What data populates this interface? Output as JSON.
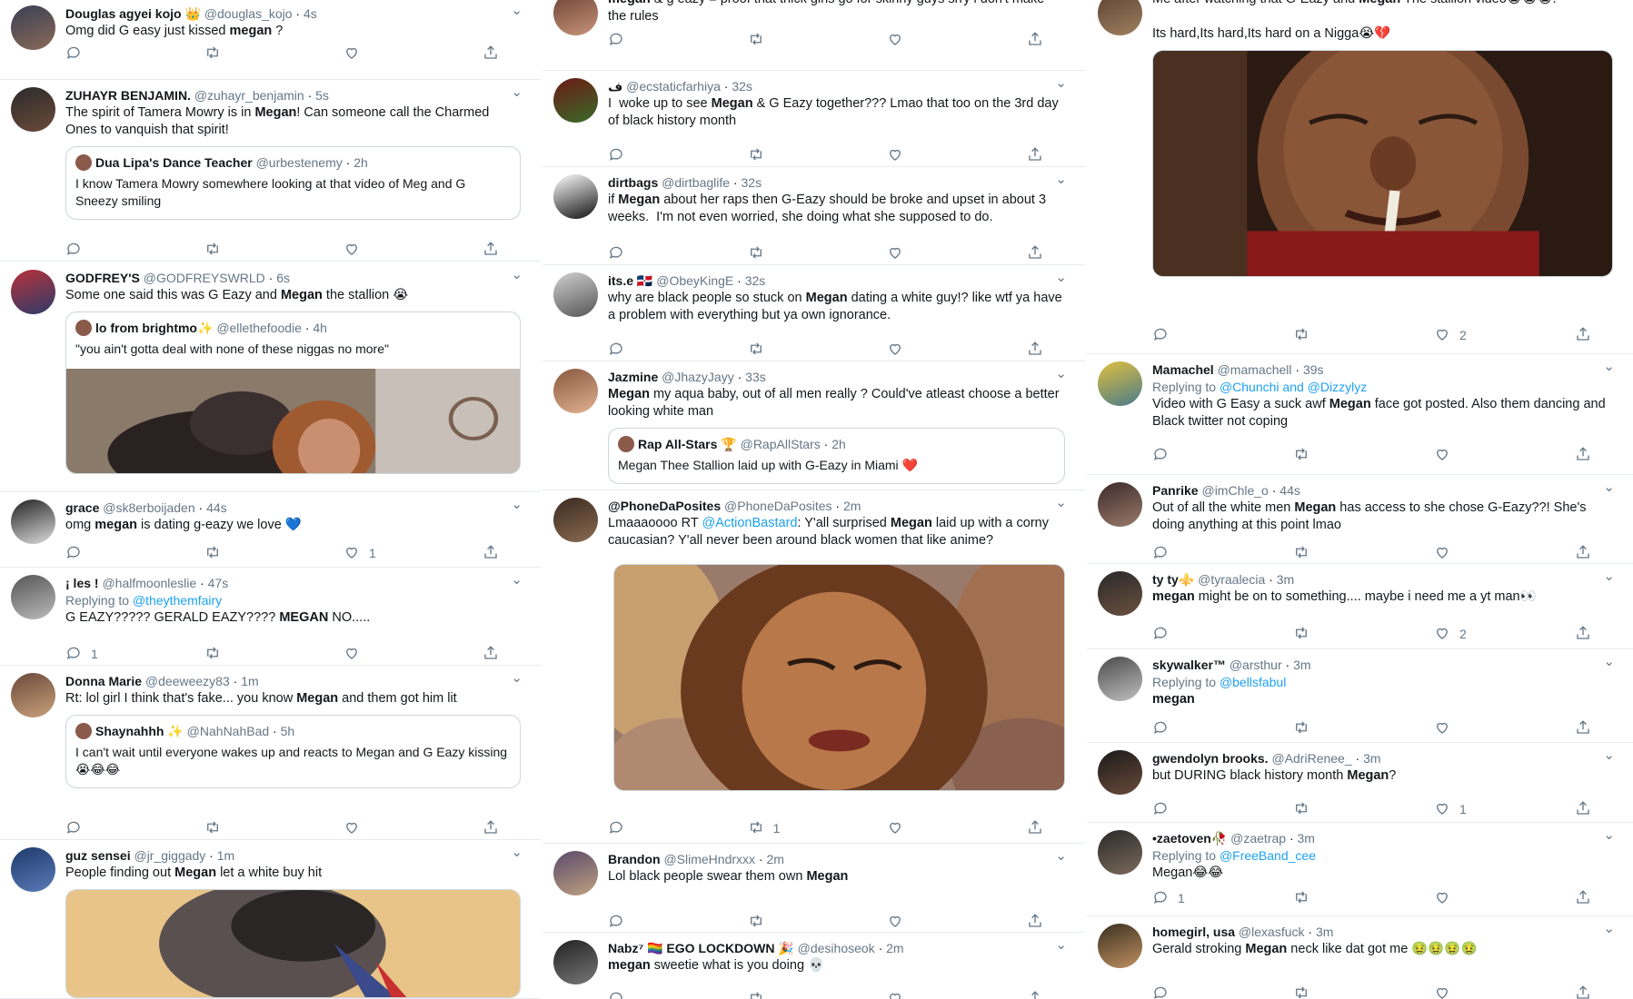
{
  "columns": [
    {
      "tweets": [
        {
          "name": "Douglas agyei kojo 👑",
          "handle": "@douglas_kojo",
          "time": "4s",
          "reply_to": "",
          "text": [
            {
              "t": "Omg did G easy just kissed "
            },
            {
              "t": "megan",
              "b": true
            },
            {
              "t": " ?"
            }
          ],
          "replies": "",
          "retweets": "",
          "likes": "",
          "avatar": [
            "#3a3f55",
            "#8a6a58"
          ]
        },
        {
          "name": "ZUHAYR BENJAMIN.",
          "handle": "@zuhayr_benjamin",
          "time": "5s",
          "reply_to": "",
          "text": [
            {
              "t": "The spirit of Tamera Mowry is in "
            },
            {
              "t": "Megan",
              "b": true
            },
            {
              "t": "! Can someone call the Charmed Ones to vanquish that spirit!"
            }
          ],
          "quote": {
            "name": "Dua Lipa's Dance Teacher",
            "handle": "@urbestenemy",
            "time": "2h",
            "text": "I know Tamera Mowry somewhere looking at that video of Meg and G Sneezy smiling",
            "media": false
          },
          "replies": "",
          "retweets": "",
          "likes": "",
          "avatar": [
            "#2b2b2b",
            "#6b4a3a"
          ]
        },
        {
          "name": "GODFREY'S",
          "handle": "@GODFREYSWRLD",
          "time": "6s",
          "reply_to": "",
          "text": [
            {
              "t": "Some one said this was G Eazy and "
            },
            {
              "t": "Megan",
              "b": true
            },
            {
              "t": " the stallion 😭"
            }
          ],
          "quote": {
            "name": "lo from brightmo✨",
            "handle": "@ellethefoodie",
            "time": "4h",
            "text": "\"you ain't gotta deal with none of these niggas no more\"",
            "media": true
          },
          "replies": "",
          "retweets": "",
          "likes": "",
          "avatar": [
            "#b8323a",
            "#2d3b6a"
          ]
        },
        {
          "name": "grace",
          "handle": "@sk8erboijaden",
          "time": "44s",
          "reply_to": "",
          "text": [
            {
              "t": "omg "
            },
            {
              "t": "megan",
              "b": true
            },
            {
              "t": " is dating g-eazy we love 💙"
            }
          ],
          "replies": "",
          "retweets": "",
          "likes": "1",
          "avatar": [
            "#222222",
            "#dddddd"
          ]
        },
        {
          "name": "¡ les !",
          "handle": "@halfmoonleslie",
          "time": "47s",
          "reply_to": "@theythemfairy",
          "text": [
            {
              "t": "G EAZY????? GERALD EAZY???? "
            },
            {
              "t": "MEGAN",
              "b": true
            },
            {
              "t": " NO....."
            }
          ],
          "replies": "1",
          "retweets": "",
          "likes": "",
          "avatar": [
            "#555555",
            "#bbbbbb"
          ]
        },
        {
          "name": "Donna Marie",
          "handle": "@deeweezy83",
          "time": "1m",
          "reply_to": "",
          "text": [
            {
              "t": "Rt: lol girl I think that's fake... you know "
            },
            {
              "t": "Megan",
              "b": true
            },
            {
              "t": " and them got him lit"
            }
          ],
          "quote": {
            "name": "Shaynahhh ✨",
            "handle": "@NahNahBad",
            "time": "5h",
            "text": "I can't wait until everyone wakes up and reacts to Megan and G Eazy kissing 😭😂😂",
            "media": false
          },
          "replies": "",
          "retweets": "",
          "likes": "",
          "avatar": [
            "#6a4a3a",
            "#c9a07a"
          ]
        },
        {
          "name": "guz sensei",
          "handle": "@jr_giggady",
          "time": "1m",
          "reply_to": "",
          "text": [
            {
              "t": "People finding out "
            },
            {
              "t": "Megan",
              "b": true
            },
            {
              "t": " let a white buy hit"
            }
          ],
          "media": "anime",
          "replies": "",
          "retweets": "",
          "likes": "",
          "avatar": [
            "#1f3a6a",
            "#5a7ab8"
          ]
        }
      ]
    },
    {
      "tweets": [
        {
          "name": "",
          "handle": "",
          "time": "",
          "reply_to": "",
          "text": [
            {
              "t": "megan",
              "b": true
            },
            {
              "t": " & g eazy = proof that thick girls go for skinny guys srry i don't make the rules"
            }
          ],
          "replies": "",
          "retweets": "",
          "likes": "",
          "avatar": [
            "#6a4030",
            "#c8937a"
          ]
        },
        {
          "name": "ف",
          "handle": "@ecstaticfarhiya",
          "time": "32s",
          "reply_to": "",
          "text": [
            {
              "t": "I  woke up to see "
            },
            {
              "t": "Megan",
              "b": true
            },
            {
              "t": " & G Eazy together??? Lmao that too on the 3rd day of black history month"
            }
          ],
          "replies": "",
          "retweets": "",
          "likes": "",
          "avatar": [
            "#6a1a14",
            "#3a6a2a"
          ]
        },
        {
          "name": "dirtbags",
          "handle": "@dirtbaglife",
          "time": "32s",
          "reply_to": "",
          "text": [
            {
              "t": "if "
            },
            {
              "t": "Megan",
              "b": true
            },
            {
              "t": " about her raps then G-Eazy should be broke and upset in about 3 weeks.  I'm not even worried, she doing what she supposed to do."
            }
          ],
          "replies": "",
          "retweets": "",
          "likes": "",
          "avatar": [
            "#ffffff",
            "#111111"
          ]
        },
        {
          "name": "its.e 🇩🇴",
          "handle": "@ObeyKingE",
          "time": "32s",
          "reply_to": "",
          "text": [
            {
              "t": "why are black people so stuck on "
            },
            {
              "t": "Megan",
              "b": true
            },
            {
              "t": " dating a white guy!? like wtf ya have a problem with everything but ya own ignorance."
            }
          ],
          "replies": "",
          "retweets": "",
          "likes": "",
          "avatar": [
            "#d0d0d0",
            "#555555"
          ]
        },
        {
          "name": "Jazmine",
          "handle": "@JhazyJayy",
          "time": "33s",
          "reply_to": "",
          "text": [
            {
              "t": "Megan",
              "b": true
            },
            {
              "t": " my aqua baby, out of all men really ? Could've atleast choose a better looking white man"
            }
          ],
          "quote": {
            "name": "Rap All-Stars 🏆",
            "handle": "@RapAllStars",
            "time": "2h",
            "text": "Megan Thee Stallion laid up with G-Eazy in Miami ❤️",
            "media": false
          },
          "replies": "",
          "retweets": "",
          "likes": "",
          "avatar": [
            "#8a5a40",
            "#e0b090"
          ]
        },
        {
          "name": "@PhoneDaPosites",
          "handle": "@PhoneDaPosites",
          "time": "2m",
          "reply_to": "",
          "text": [
            {
              "t": "Lmaaaoooo RT "
            },
            {
              "t": "@ActionBastard",
              "l": true
            },
            {
              "t": ": Y'all surprised "
            },
            {
              "t": "Megan",
              "b": true
            },
            {
              "t": " laid up with a corny caucasian? Y'all never been around black women that like anime?"
            }
          ],
          "media": "wendy",
          "replies": "",
          "retweets": "1",
          "likes": "",
          "avatar": [
            "#3a2a20",
            "#8a6a50"
          ]
        },
        {
          "name": "Brandon",
          "handle": "@SlimeHndrxxx",
          "time": "2m",
          "reply_to": "",
          "text": [
            {
              "t": "Lol black people swear them own "
            },
            {
              "t": "Megan",
              "b": true
            }
          ],
          "replies": "",
          "retweets": "",
          "likes": "",
          "avatar": [
            "#5a4a6a",
            "#c0a080"
          ]
        },
        {
          "name": "Nabz⁷ 🏳️‍🌈 EGO LOCKDOWN 🎉",
          "handle": "@desihoseok",
          "time": "2m",
          "reply_to": "",
          "text": [
            {
              "t": "megan",
              "b": true
            },
            {
              "t": " sweetie what is you doing 💀"
            }
          ],
          "replies": "",
          "retweets": "",
          "likes": "",
          "avatar": [
            "#222222",
            "#777777"
          ]
        }
      ]
    },
    {
      "tweets": [
        {
          "name": "",
          "handle": "",
          "time": "",
          "reply_to": "",
          "text": [
            {
              "t": "Me after watching that G-Eazy and "
            },
            {
              "t": "Megan",
              "b": true
            },
            {
              "t": " The stallion video😭😭😭."
            },
            {
              "t": "\n\nIts hard,Its hard,Its hard on a Nigga😭💔"
            }
          ],
          "media": "crying",
          "replies": "",
          "retweets": "",
          "likes": "2",
          "avatar": [
            "#5a4030",
            "#a08060"
          ]
        },
        {
          "name": "Mamachel",
          "handle": "@mamachell",
          "time": "39s",
          "reply_to": "@Chunchi and @Dizzylyz",
          "text": [
            {
              "t": "Video with G Easy a suck awf "
            },
            {
              "t": "Megan",
              "b": true
            },
            {
              "t": " face got posted. Also them dancing and Black twitter not coping"
            }
          ],
          "replies": "",
          "retweets": "",
          "likes": "",
          "avatar": [
            "#e0c040",
            "#4a7a8a"
          ]
        },
        {
          "name": "Panrike",
          "handle": "@imChle_o",
          "time": "44s",
          "reply_to": "",
          "text": [
            {
              "t": "Out of all the white men "
            },
            {
              "t": "Megan",
              "b": true
            },
            {
              "t": " has access to she chose G-Eazy??! She's doing anything at this point lmao"
            }
          ],
          "replies": "",
          "retweets": "",
          "likes": "",
          "avatar": [
            "#3a2a2a",
            "#9a7a6a"
          ]
        },
        {
          "name": "ty ty⚜️",
          "handle": "@tyraalecia",
          "time": "3m",
          "reply_to": "",
          "text": [
            {
              "t": "megan",
              "b": true
            },
            {
              "t": " might be on to something.... maybe i need me a yt man👀"
            }
          ],
          "replies": "",
          "retweets": "",
          "likes": "2",
          "avatar": [
            "#2a2a2a",
            "#6a5040"
          ]
        },
        {
          "name": "skywalker™",
          "handle": "@arsthur",
          "time": "3m",
          "reply_to": "@bellsfabul",
          "text": [
            {
              "t": "megan",
              "b": true
            }
          ],
          "replies": "",
          "retweets": "",
          "likes": "",
          "avatar": [
            "#4a4a4a",
            "#c0c0c0"
          ]
        },
        {
          "name": "gwendolyn brooks.",
          "handle": "@AdriRenee_",
          "time": "3m",
          "reply_to": "",
          "text": [
            {
              "t": "but DURING black history month "
            },
            {
              "t": "Megan",
              "b": true
            },
            {
              "t": "?"
            }
          ],
          "replies": "",
          "retweets": "",
          "likes": "1",
          "avatar": [
            "#1a1a1a",
            "#6a4a3a"
          ]
        },
        {
          "name": "•zaetoven🥀",
          "handle": "@zaetrap",
          "time": "3m",
          "reply_to": "@FreeBand_cee",
          "text": [
            {
              "t": "Megan😂😂"
            }
          ],
          "replies": "1",
          "retweets": "",
          "likes": "",
          "avatar": [
            "#2a2a2a",
            "#7a6a5a"
          ]
        },
        {
          "name": "homegirl, usa",
          "handle": "@lexasfuck",
          "time": "3m",
          "reply_to": "",
          "text": [
            {
              "t": "Gerald stroking "
            },
            {
              "t": "Megan",
              "b": true
            },
            {
              "t": " neck like dat got me 🤢🤢🤢🤢"
            }
          ],
          "replies": "",
          "retweets": "",
          "likes": "",
          "avatar": [
            "#3a3020",
            "#c09060"
          ]
        }
      ]
    }
  ],
  "colors": {
    "text": "#14171a",
    "muted": "#657786",
    "link": "#1da1f2",
    "border": "#e6ecf0"
  },
  "icons": [
    "reply-icon",
    "retweet-icon",
    "like-icon",
    "share-icon",
    "caret-down-icon"
  ]
}
